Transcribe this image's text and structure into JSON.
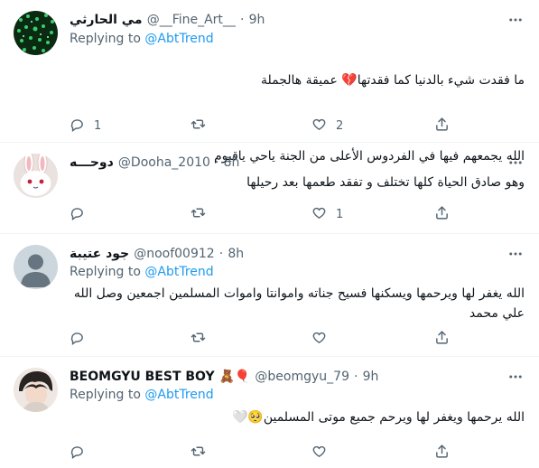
{
  "tweets": [
    {
      "display_name": "مي الحارثي",
      "handle": "@__Fine_Art__",
      "time": "9h",
      "replying_prefix": "Replying to ",
      "replying_to": "@AbtTrend",
      "text_line1": "ما فقدت شيء بالدنيا كما فقدتها💔 عميقة هالجملة",
      "text_line2": "الله يجمعهم فيها في الفردوس الأعلى من الجنة ياحي ياقيوم",
      "reply_count": "1",
      "retweet_count": "",
      "like_count": "2"
    },
    {
      "display_name": "دوحـــه",
      "handle": "@Dooha_2010",
      "time": "8h",
      "text": "وهو صادق الحياة كلها تختلف و تفقد طعمها بعد رحيلها",
      "reply_count": "",
      "retweet_count": "",
      "like_count": "1"
    },
    {
      "display_name": "جود عتيبة",
      "handle": "@noof00912",
      "time": "8h",
      "replying_prefix": "Replying to ",
      "replying_to": "@AbtTrend",
      "text": "الله يغفر لها ويرحمها ويسكنها فسيح جناته واموانتا واموات المسلمين اجمعين وصل الله علي محمد",
      "reply_count": "",
      "retweet_count": "",
      "like_count": ""
    },
    {
      "display_name": "BEOMGYU BEST BOY 🧸🎈",
      "handle": "@beomgyu_79",
      "time": "9h",
      "replying_prefix": "Replying to ",
      "replying_to": "@AbtTrend",
      "text": "الله يرحمها ويغفر لها ويرحم جميع موتى المسلمين🥺🤍",
      "reply_count": "",
      "retweet_count": "",
      "like_count": ""
    }
  ],
  "separator": "·",
  "icons": {
    "more": "more-horizontal-icon",
    "reply": "reply-icon",
    "retweet": "retweet-icon",
    "like": "heart-icon",
    "share": "share-icon"
  },
  "colors": {
    "link": "#1d9bf0",
    "secondary_text": "#536471",
    "primary_text": "#0f1419",
    "divider": "#eff3f4"
  }
}
